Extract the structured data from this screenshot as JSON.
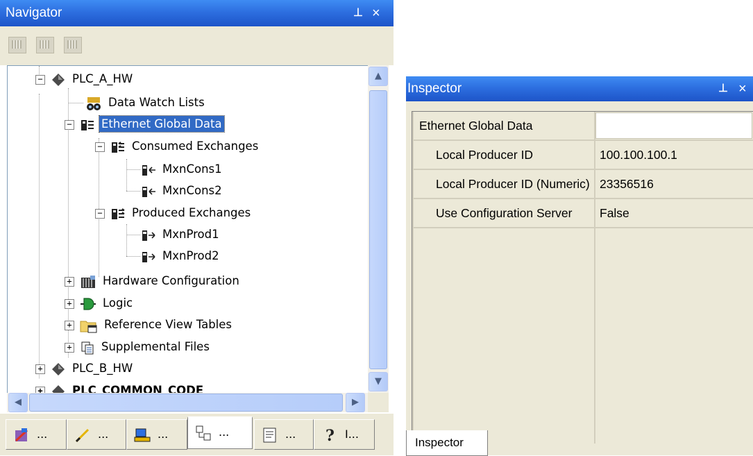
{
  "navigator": {
    "title": "Navigator",
    "pin_icon": "ᵖ",
    "close_icon": "×",
    "tree": [
      {
        "label": "PLC_A_HW",
        "expander": "−",
        "icon": "plc-target-icon"
      },
      {
        "label": "Data Watch Lists",
        "icon": "data-watch-icon"
      },
      {
        "label": "Ethernet Global Data",
        "expander": "−",
        "icon": "egd-icon",
        "selected": true
      },
      {
        "label": "Consumed Exchanges",
        "expander": "−",
        "icon": "consumed-exchanges-icon"
      },
      {
        "label": "MxnCons1",
        "icon": "consumed-exchange-icon"
      },
      {
        "label": "MxnCons2",
        "icon": "consumed-exchange-icon"
      },
      {
        "label": "Produced Exchanges",
        "expander": "−",
        "icon": "produced-exchanges-icon"
      },
      {
        "label": "MxnProd1",
        "icon": "produced-exchange-icon"
      },
      {
        "label": "MxnProd2",
        "icon": "produced-exchange-icon"
      },
      {
        "label": "Hardware Configuration",
        "expander": "+",
        "icon": "hardware-config-icon"
      },
      {
        "label": "Logic",
        "expander": "+",
        "icon": "logic-icon"
      },
      {
        "label": "Reference View Tables",
        "expander": "+",
        "icon": "reference-view-icon"
      },
      {
        "label": "Supplemental Files",
        "expander": "+",
        "icon": "supplemental-files-icon"
      },
      {
        "label": "PLC_B_HW",
        "expander": "+",
        "icon": "plc-target-icon"
      },
      {
        "label": "PLC_COMMON_CODE",
        "expander": "+",
        "icon": "plc-target-icon"
      }
    ],
    "scroll_up": "▲",
    "scroll_down": "▼",
    "scroll_left": "◀",
    "scroll_right": "▶",
    "tabs": [
      {
        "label": "...",
        "icon": "project-tab-icon"
      },
      {
        "label": "...",
        "icon": "toolchest-tab-icon"
      },
      {
        "label": "...",
        "icon": "companion-tab-icon"
      },
      {
        "label": "...",
        "icon": "navigator-tab-icon",
        "active": true
      },
      {
        "label": "...",
        "icon": "feedback-tab-icon"
      },
      {
        "label": "I...",
        "icon": "info-tab-icon"
      }
    ]
  },
  "inspector": {
    "title": "Inspector",
    "pin_icon": "ᵖ",
    "close_icon": "×",
    "rows": [
      {
        "name": "Ethernet Global Data",
        "value": ""
      },
      {
        "name": "Local Producer ID",
        "value": "100.100.100.1"
      },
      {
        "name": "Local Producer ID (Numeric)",
        "value": "23356516"
      },
      {
        "name": "Use Configuration Server",
        "value": "False"
      }
    ],
    "tab_label": "Inspector"
  }
}
